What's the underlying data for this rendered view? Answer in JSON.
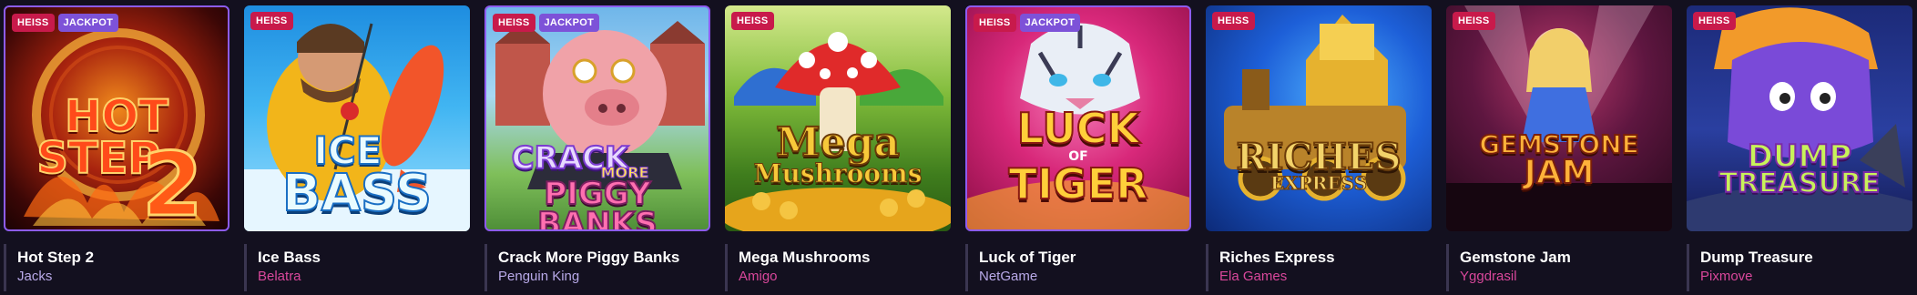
{
  "colors": {
    "background": "#13101f",
    "hot_badge": "#c81a4b",
    "jackpot_badge": "#7d52d8",
    "provider_text": "#d9479b",
    "provider_text_alt": "#b8a9e8",
    "selected_border": "#8d5cf0"
  },
  "games": [
    {
      "title": "Hot Step 2",
      "provider": "Jacks",
      "badges": [
        "HEISS",
        "JACKPOT"
      ],
      "logo": [
        "HOT",
        "STEP",
        "2"
      ]
    },
    {
      "title": "Ice Bass",
      "provider": "Belatra",
      "badges": [
        "HEISS"
      ],
      "logo": [
        "ICE",
        "BASS"
      ]
    },
    {
      "title": "Crack More Piggy Banks",
      "provider": "Penguin King",
      "badges": [
        "HEISS",
        "JACKPOT"
      ],
      "logo": [
        "CRACK",
        "MORE",
        "PIGGY BANKS"
      ]
    },
    {
      "title": "Mega Mushrooms",
      "provider": "Amigo",
      "badges": [
        "HEISS"
      ],
      "logo": [
        "Mega",
        "Mushrooms"
      ]
    },
    {
      "title": "Luck of Tiger",
      "provider": "NetGame",
      "badges": [
        "HEISS",
        "JACKPOT"
      ],
      "logo": [
        "LUCK",
        "OF",
        "TIGER"
      ]
    },
    {
      "title": "Riches Express",
      "provider": "Ela Games",
      "badges": [
        "HEISS"
      ],
      "logo": [
        "RICHES",
        "EXPRESS"
      ]
    },
    {
      "title": "Gemstone Jam",
      "provider": "Yggdrasil",
      "badges": [
        "HEISS"
      ],
      "logo": [
        "GEMSTONE",
        "JAM"
      ]
    },
    {
      "title": "Dump Treasure",
      "provider": "Pixmove",
      "badges": [
        "HEISS"
      ],
      "logo": [
        "DUMP",
        "TREASURE"
      ]
    }
  ]
}
